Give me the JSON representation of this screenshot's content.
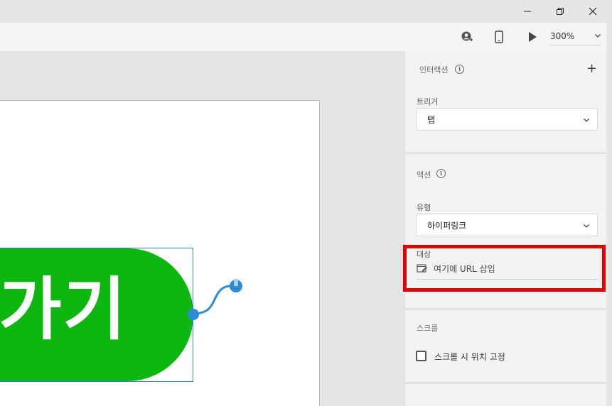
{
  "window": {
    "minimize_icon": "minimize-icon",
    "restore_icon": "restore-icon",
    "close_icon": "close-icon"
  },
  "toolbar": {
    "share_icon": "user-share-icon",
    "device_icon": "mobile-preview-icon",
    "play_icon": "play-icon",
    "zoom": "300%"
  },
  "canvas": {
    "button_text": "로가기",
    "button_color": "#0db70f",
    "selection_color": "#2c8bd8"
  },
  "panel": {
    "interaction": {
      "title": "인터랙션",
      "add_icon": "plus-icon"
    },
    "trigger": {
      "label": "트리거",
      "value": "탭"
    },
    "action": {
      "title": "액션",
      "type_label": "유형",
      "type_value": "하이퍼링크",
      "target_label": "대상",
      "url_placeholder": "여기에 URL 삽입"
    },
    "scroll": {
      "title": "스크롤",
      "fix_label": "스크롤 시 위치 고정",
      "fix_checked": false
    }
  },
  "highlight_color": "#e60000"
}
